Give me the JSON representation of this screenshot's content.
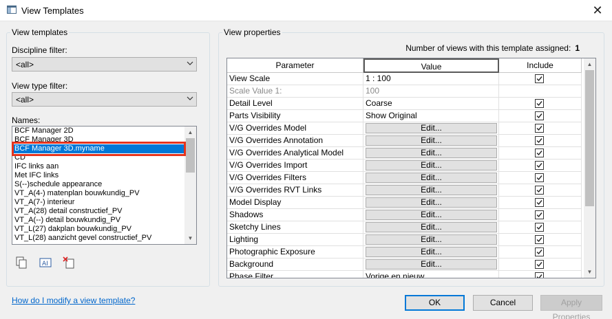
{
  "window": {
    "title": "View Templates",
    "close_glyph": "✕"
  },
  "left": {
    "group_title": "View templates",
    "discipline_label": "Discipline filter:",
    "discipline_value": "<all>",
    "view_type_label": "View type filter:",
    "view_type_value": "<all>",
    "names_label": "Names:",
    "names": [
      "BCF Manager 2D",
      "BCF Manager 3D",
      "BCF Manager 3D.myname",
      "CD",
      "IFC links aan",
      "Met IFC links",
      "S(--)schedule appearance",
      "VT_A(4-) matenplan bouwkundig_PV",
      "VT_A(7-) interieur",
      "VT_A(28) detail constructief_PV",
      "VT_A(--) detail bouwkundig_PV",
      "VT_L(27) dakplan bouwkundig_PV",
      "VT_L(28) aanzicht gevel constructief_PV"
    ],
    "selected_index": 2,
    "tools": [
      "duplicate-icon",
      "rename-icon",
      "delete-icon"
    ]
  },
  "right": {
    "group_title": "View properties",
    "views_count_label": "Number of views with this template assigned:",
    "views_count": "1",
    "headers": {
      "parameter": "Parameter",
      "value": "Value",
      "include": "Include"
    },
    "rows": [
      {
        "param": "View Scale",
        "value": "1 : 100",
        "include": true
      },
      {
        "param": "Scale Value    1:",
        "value": "100",
        "include": null,
        "dim": true
      },
      {
        "param": "Detail Level",
        "value": "Coarse",
        "include": true
      },
      {
        "param": "Parts Visibility",
        "value": "Show Original",
        "include": true
      },
      {
        "param": "V/G Overrides Model",
        "value": "Edit...",
        "button": true,
        "include": true
      },
      {
        "param": "V/G Overrides Annotation",
        "value": "Edit...",
        "button": true,
        "include": true
      },
      {
        "param": "V/G Overrides Analytical Model",
        "value": "Edit...",
        "button": true,
        "include": true
      },
      {
        "param": "V/G Overrides Import",
        "value": "Edit...",
        "button": true,
        "include": true
      },
      {
        "param": "V/G Overrides Filters",
        "value": "Edit...",
        "button": true,
        "include": true
      },
      {
        "param": "V/G Overrides RVT Links",
        "value": "Edit...",
        "button": true,
        "include": true
      },
      {
        "param": "Model Display",
        "value": "Edit...",
        "button": true,
        "include": true
      },
      {
        "param": "Shadows",
        "value": "Edit...",
        "button": true,
        "include": true
      },
      {
        "param": "Sketchy Lines",
        "value": "Edit...",
        "button": true,
        "include": true
      },
      {
        "param": "Lighting",
        "value": "Edit...",
        "button": true,
        "include": true
      },
      {
        "param": "Photographic Exposure",
        "value": "Edit...",
        "button": true,
        "include": true
      },
      {
        "param": "Background",
        "value": "Edit...",
        "button": true,
        "include": true
      },
      {
        "param": "Phase Filter",
        "value": "Vorige en nieuw",
        "include": true
      }
    ]
  },
  "footer": {
    "help_link": "How do I modify a view template?",
    "ok": "OK",
    "cancel": "Cancel",
    "apply": "Apply Properties"
  },
  "colors": {
    "selection": "#0078d7",
    "highlight_outline": "#e5341d",
    "link": "#0066cc"
  }
}
